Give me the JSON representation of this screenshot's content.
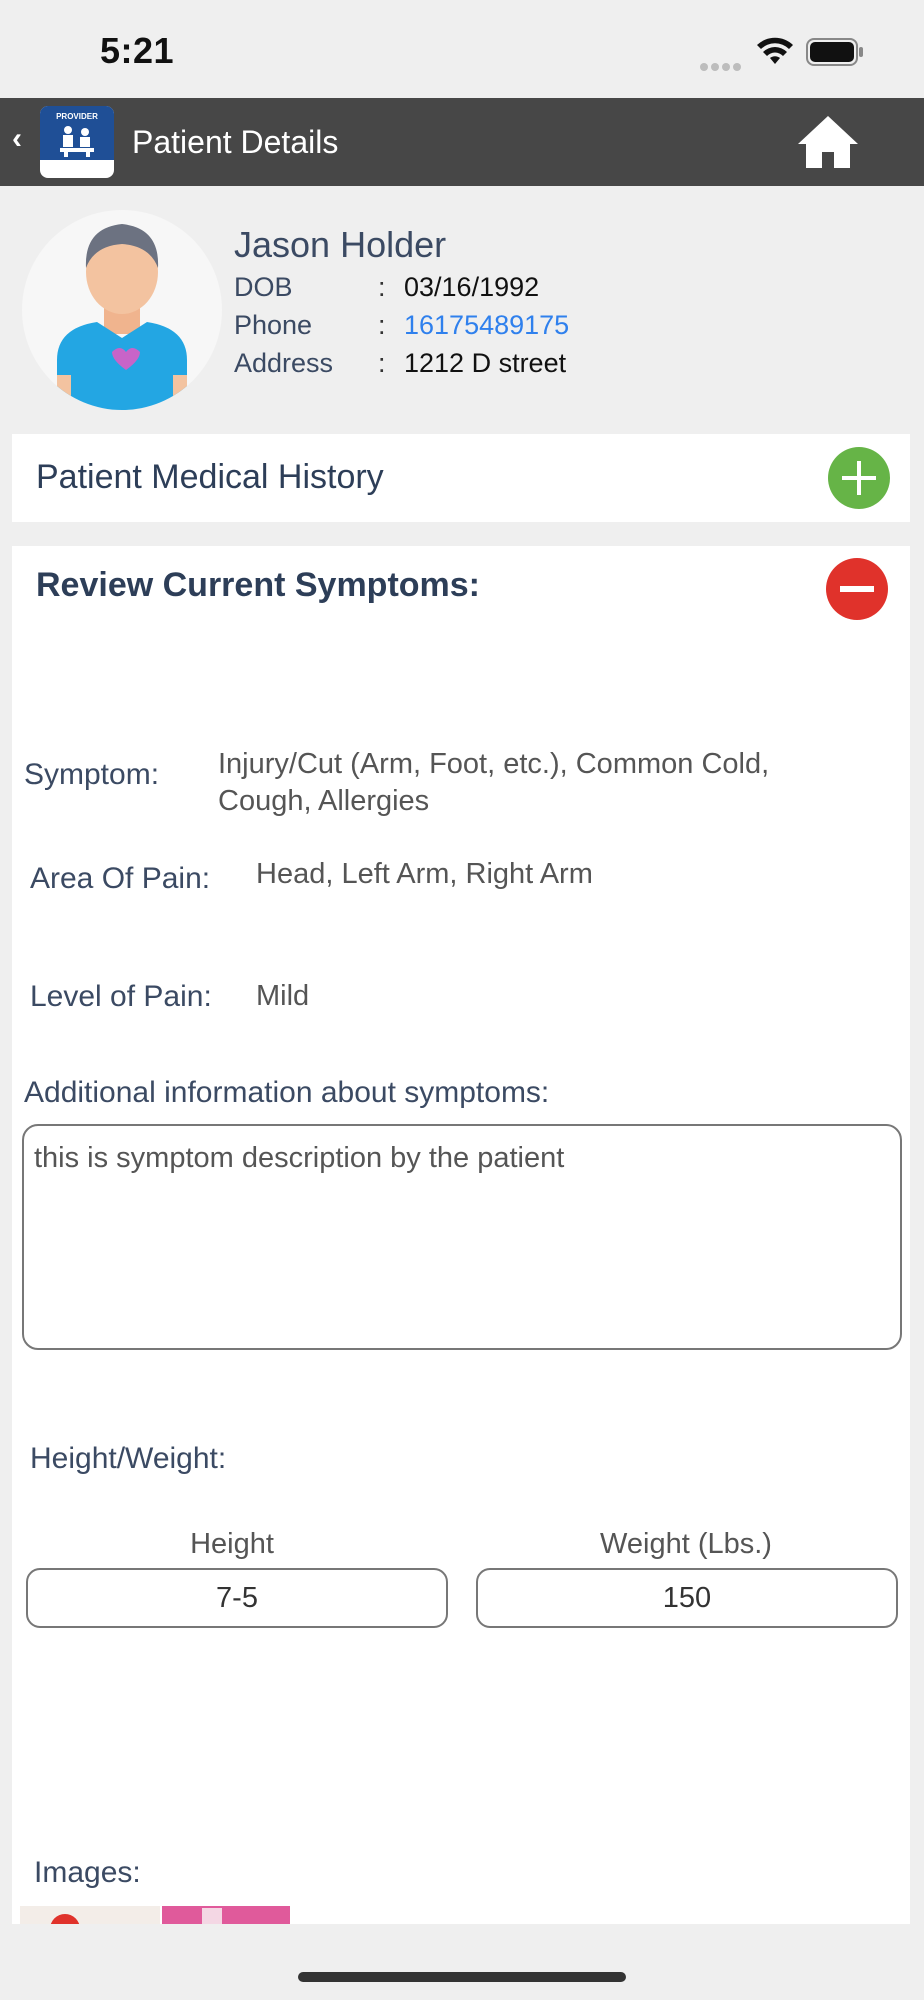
{
  "status_bar": {
    "time": "5:21"
  },
  "nav": {
    "title": "Patient Details",
    "logo_text": "PROVIDER"
  },
  "patient": {
    "name": "Jason Holder",
    "dob_label": "DOB",
    "dob": "03/16/1992",
    "phone_label": "Phone",
    "phone": "16175489175",
    "address_label": "Address",
    "address": "1212 D street",
    "colon": ":"
  },
  "history": {
    "title": "Patient Medical History"
  },
  "symptoms": {
    "title": "Review Current Symptoms:",
    "symptom_label": "Symptom:",
    "symptom_value": "Injury/Cut (Arm, Foot, etc.), Common Cold, Cough, Allergies",
    "area_label": "Area Of Pain:",
    "area_value": "Head, Left Arm, Right Arm",
    "level_label": "Level of Pain:",
    "level_value": "Mild",
    "additional_label": "Additional information about symptoms:",
    "additional_value": "this is symptom description by the patient",
    "hw_label": "Height/Weight:",
    "height_label": "Height",
    "height_value": "7-5",
    "weight_label": "Weight (Lbs.)",
    "weight_value": "150",
    "images_label": "Images:"
  },
  "colors": {
    "navbar": "#474747",
    "plus": "#66b447",
    "minus": "#e0322b",
    "link": "#2f80ed"
  }
}
